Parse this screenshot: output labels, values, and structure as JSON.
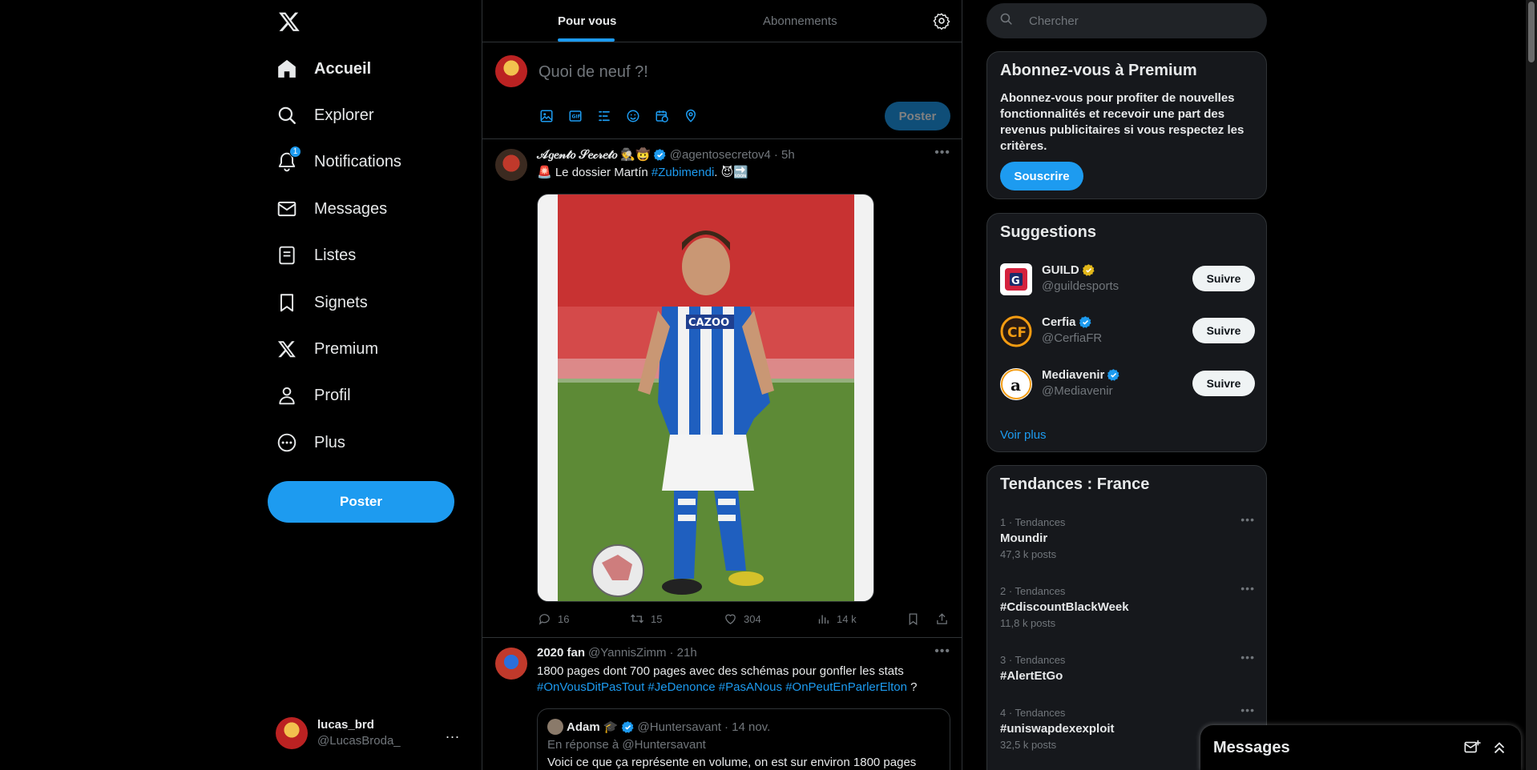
{
  "nav": {
    "items": [
      {
        "label": "Accueil",
        "icon": "home-icon"
      },
      {
        "label": "Explorer",
        "icon": "search-icon"
      },
      {
        "label": "Notifications",
        "icon": "bell-icon",
        "badge": "1"
      },
      {
        "label": "Messages",
        "icon": "mail-icon"
      },
      {
        "label": "Listes",
        "icon": "list-icon"
      },
      {
        "label": "Signets",
        "icon": "bookmark-icon"
      },
      {
        "label": "Premium",
        "icon": "x-logo-icon"
      },
      {
        "label": "Profil",
        "icon": "person-icon"
      },
      {
        "label": "Plus",
        "icon": "more-circle-icon"
      }
    ],
    "post_label": "Poster"
  },
  "account": {
    "name": "lucas_brd",
    "handle": "@LucasBroda_",
    "more": "..."
  },
  "tabs": [
    {
      "label": "Pour vous"
    },
    {
      "label": "Abonnements"
    }
  ],
  "composer": {
    "placeholder": "Quoi de neuf ?!",
    "post_label": "Poster"
  },
  "tweets": [
    {
      "name": "𝒜𝑔𝑒𝓃𝓉𝑜 𝒮𝑒𝒸𝓇𝑒𝓉𝑜 🕵️🤠",
      "handle": "@agentosecretov4",
      "time": "· 5h",
      "text_prefix": "🚨 Le dossier Martín ",
      "hashtag": "#Zubimendi",
      "text_suffix": ". 😈🔜",
      "stats": {
        "replies": "16",
        "retweets": "15",
        "likes": "304",
        "views": "14 k"
      }
    },
    {
      "name": "2020 fan",
      "handle": "@YannisZimm",
      "time": "· 21h",
      "text": "1800 pages dont 700 pages avec des schémas pour gonfler les stats",
      "hashtags": "#OnVousDitPasTout #JeDenonce #PasANous #OnPeutEnParlerElton",
      "text_suffix": " ?",
      "quote": {
        "name": "Adam 🎓",
        "handle": "@Huntersavant",
        "time": "· 14 nov.",
        "reply_to": "En réponse à @Huntersavant",
        "text": "Voici ce que ça représente en volume, on est sur environ 1800 pages"
      }
    }
  ],
  "search": {
    "placeholder": "Chercher"
  },
  "premium": {
    "title": "Abonnez-vous à Premium",
    "text": "Abonnez-vous pour profiter de nouvelles fonctionnalités et recevoir une part des revenus publicitaires si vous respectez les critères.",
    "button": "Souscrire"
  },
  "suggestions": {
    "title": "Suggestions",
    "items": [
      {
        "name": "GUILD",
        "handle": "@guildesports",
        "verified": "gold",
        "button": "Suivre"
      },
      {
        "name": "Cerfia",
        "handle": "@CerfiaFR",
        "verified": "blue",
        "button": "Suivre"
      },
      {
        "name": "Mediavenir",
        "handle": "@Mediavenir",
        "verified": "blue",
        "button": "Suivre"
      }
    ],
    "see_more": "Voir plus"
  },
  "trends": {
    "title": "Tendances : France",
    "items": [
      {
        "meta": "1 · Tendances",
        "name": "Moundir",
        "count": "47,3 k posts"
      },
      {
        "meta": "2 · Tendances",
        "name": "#CdiscountBlackWeek",
        "count": "11,8 k posts"
      },
      {
        "meta": "3 · Tendances",
        "name": "#AlertEtGo",
        "count": ""
      },
      {
        "meta": "4 · Tendances",
        "name": "#uniswapdexexploit",
        "count": "32,5 k posts"
      }
    ]
  },
  "dm_drawer": {
    "title": "Messages"
  },
  "colors": {
    "accent": "#1d9bf0",
    "background": "#000000",
    "border": "#2f3336",
    "muted": "#71767b"
  }
}
